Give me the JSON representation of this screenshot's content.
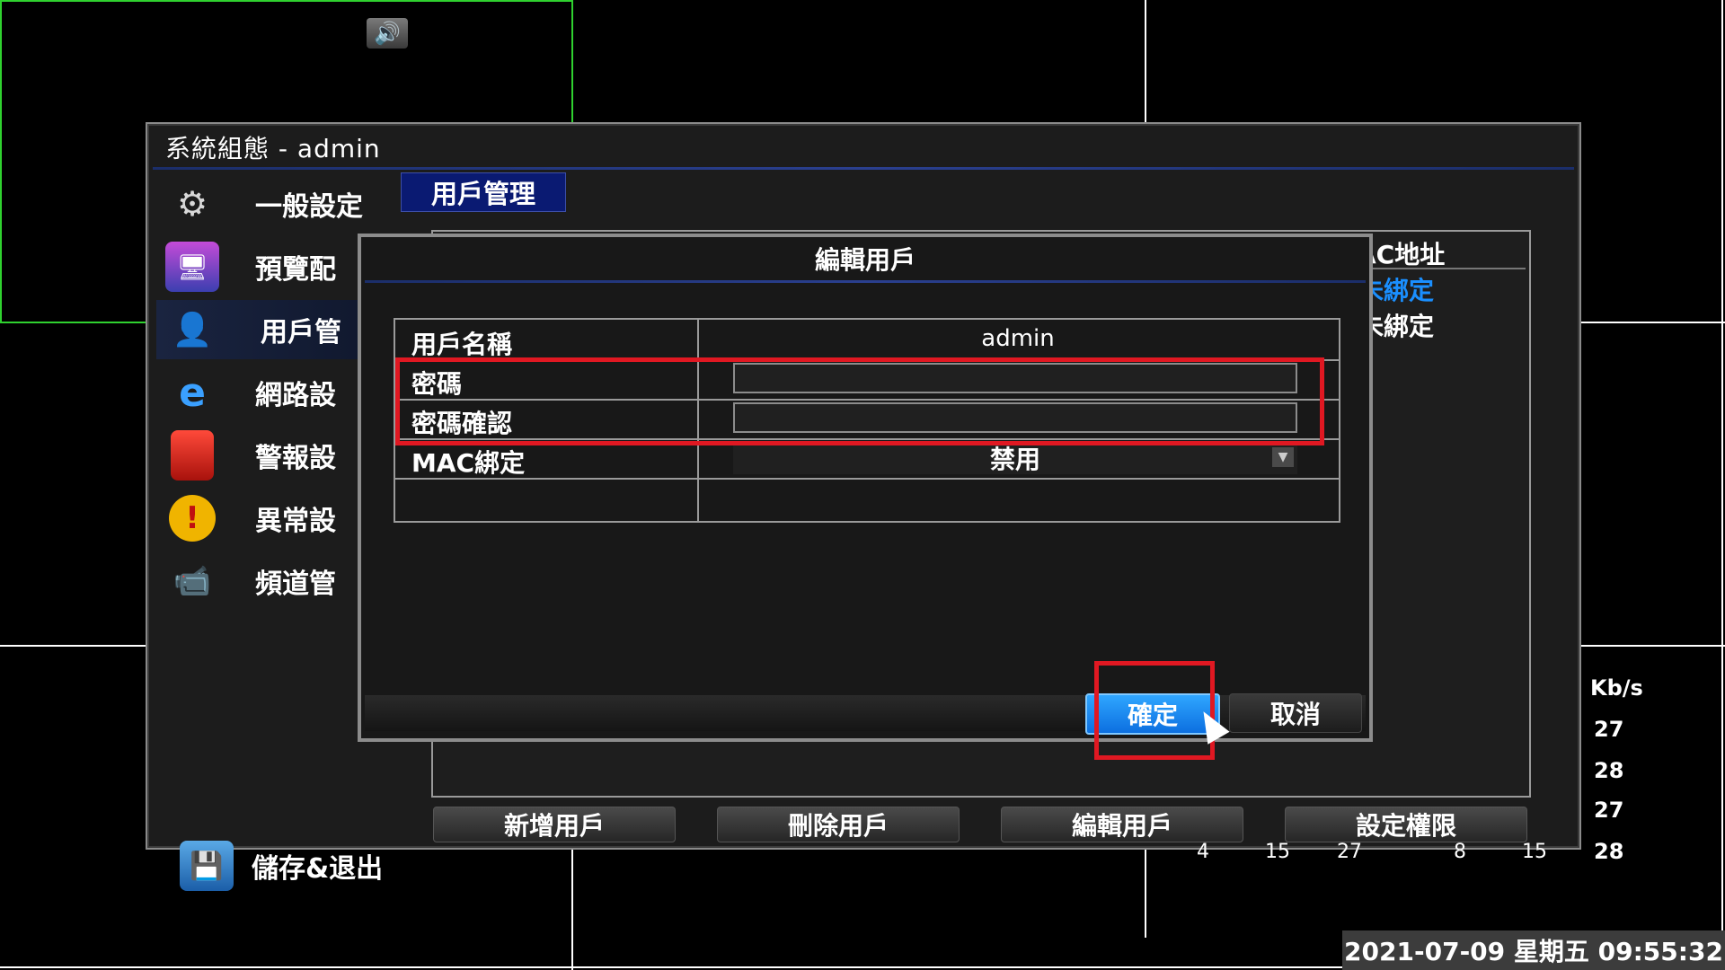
{
  "window": {
    "title": "系統組態 - admin"
  },
  "sidebar": {
    "items": [
      {
        "label": "一般設定",
        "icon": "gear-icon"
      },
      {
        "label": "預覽配",
        "icon": "monitor-icon"
      },
      {
        "label": "用戶管",
        "icon": "user-icon"
      },
      {
        "label": "網路設",
        "icon": "internet-icon"
      },
      {
        "label": "警報設",
        "icon": "alarm-light-icon"
      },
      {
        "label": "異常設",
        "icon": "warning-icon"
      },
      {
        "label": "頻道管",
        "icon": "camera-icon"
      }
    ],
    "save_exit": {
      "label": "儲存&退出",
      "icon": "floppy-disk-icon"
    }
  },
  "tab": {
    "label": "用戶管理"
  },
  "user_table": {
    "mac_header": "AC地址",
    "mac_rows": [
      "未綁定",
      "未綁定"
    ]
  },
  "bottom_buttons": {
    "add": "新增用戶",
    "delete": "刪除用戶",
    "edit": "編輯用戶",
    "permissions": "設定權限"
  },
  "stats": {
    "unit": "Kb/s",
    "values": [
      "27",
      "28",
      "27",
      "28"
    ],
    "bottom_row": [
      "4",
      "15",
      "27",
      "8",
      "15"
    ]
  },
  "modal": {
    "title": "編輯用戶",
    "fields": {
      "username_label": "用戶名稱",
      "username_value": "admin",
      "password_label": "密碼",
      "password_value": "",
      "confirm_label": "密碼確認",
      "confirm_value": "",
      "mac_label": "MAC綁定",
      "mac_value": "禁用"
    },
    "ok_label": "確定",
    "cancel_label": "取消"
  },
  "status": {
    "datetime": "2021-07-09 星期五 09:55:32"
  },
  "colors": {
    "highlight_red": "#e01822",
    "ok_blue": "#0c6fe0",
    "tab_blue": "#0a1a72",
    "mac_blue": "#1a8fff"
  }
}
